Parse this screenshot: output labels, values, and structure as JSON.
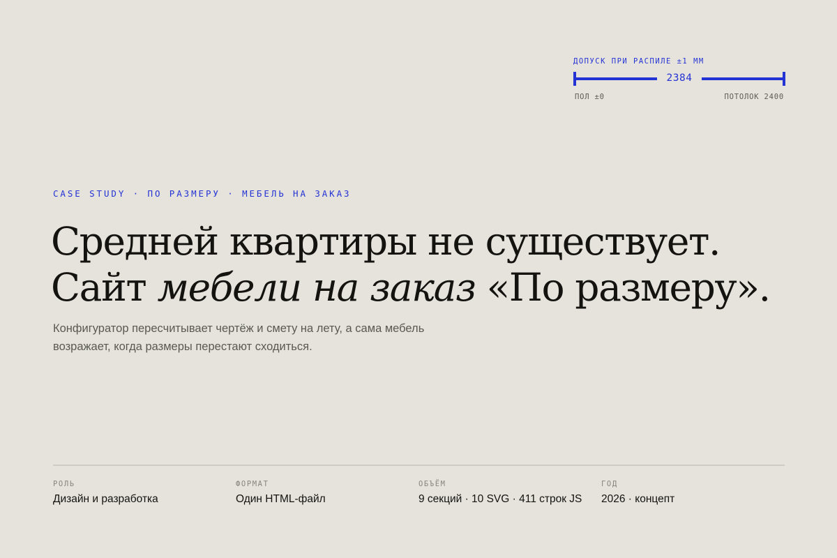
{
  "tolerance_widget": {
    "caption": "ДОПУСК ПРИ РАСПИЛЕ ±1 ММ",
    "value": "2384",
    "floor_label": "ПОЛ ±0",
    "ceiling_label": "ПОТОЛОК 2400",
    "accent_color": "#2433d4"
  },
  "hero": {
    "eyebrow": "CASE STUDY · ПО РАЗМЕРУ · МЕБЕЛЬ НА ЗАКАЗ",
    "headline_line1": "Средней квартиры не существует.",
    "headline_line2_start": "Сайт ",
    "headline_line2_italic": "мебели на заказ",
    "headline_line2_end": " «По размеру».",
    "lead": "Конфигуратор пересчитывает чертёж и смету на лету, а сама мебель возражает, когда размеры перестают сходиться."
  },
  "meta": [
    {
      "label": "РОЛЬ",
      "value": "Дизайн и разработка"
    },
    {
      "label": "ФОРМАТ",
      "value": "Один HTML-файл"
    },
    {
      "label": "ОБЪЁМ",
      "value": "9 секций · 10 SVG · 411 строк JS"
    },
    {
      "label": "ГОД",
      "value": "2026 · концепт"
    }
  ],
  "colors": {
    "background": "#e6e3dd",
    "accent": "#2433d4",
    "text": "#14130f",
    "muted": "#5a5852"
  }
}
